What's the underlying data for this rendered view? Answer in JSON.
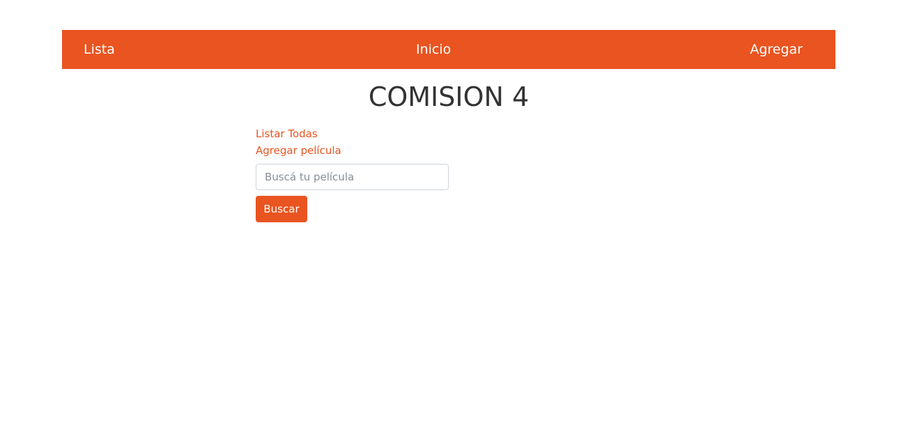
{
  "colors": {
    "brand": "#e95420",
    "title": "#333333",
    "background": "#ffffff"
  },
  "navbar": {
    "items": [
      {
        "label": "Lista"
      },
      {
        "label": "Inicio"
      },
      {
        "label": "Agregar"
      }
    ]
  },
  "main": {
    "title": "COMISION 4",
    "links": [
      {
        "label": "Listar Todas"
      },
      {
        "label": "Agregar película"
      }
    ],
    "search": {
      "placeholder": "Buscá tu película",
      "value": "",
      "button_label": "Buscar"
    }
  }
}
